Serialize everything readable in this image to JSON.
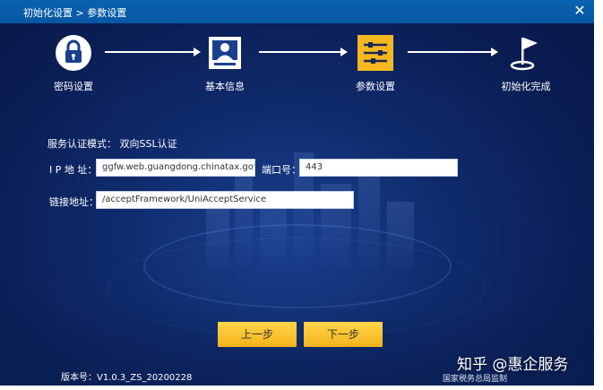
{
  "titlebar": {
    "title": "初始化设置 > 参数设置",
    "close_icon": "close-icon"
  },
  "steps": [
    {
      "label": "密码设置",
      "icon": "lock-icon"
    },
    {
      "label": "基本信息",
      "icon": "id-card-icon"
    },
    {
      "label": "参数设置",
      "icon": "sliders-icon",
      "active": true
    },
    {
      "label": "初始化完成",
      "icon": "finish-flag-icon"
    }
  ],
  "form": {
    "mode_text": "服务认证模式：  双向SSL认证",
    "ip_label": "I P 地 址：",
    "ip_value": "ggfw.web.guangdong.chinatax.gov.cn",
    "port_label": "端口号：",
    "port_value": "443",
    "url_label": "链接地址：",
    "url_value": "/acceptFramework/UniAcceptService"
  },
  "buttons": {
    "prev_label": "上一步",
    "next_label": "下一步"
  },
  "footer": {
    "version": "版本号：V1.0.3_ZS_20200228",
    "supervisor": "国家税务总局监制"
  },
  "watermark": "知乎 @惠企服务",
  "colors": {
    "accent_yellow": "#f5b820",
    "background_blue": "#0f2a6b",
    "titlebar_blue": "#0a62b0"
  }
}
